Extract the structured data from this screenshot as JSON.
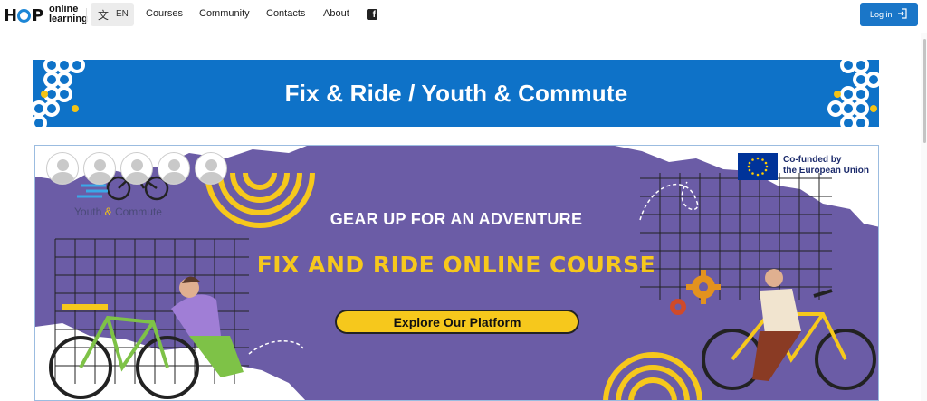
{
  "header": {
    "logo": {
      "brand": "HOP",
      "line1": "online",
      "line2": "learning"
    },
    "language": {
      "icon": "translate-icon",
      "label": "EN"
    },
    "nav": [
      {
        "label": "Courses"
      },
      {
        "label": "Community"
      },
      {
        "label": "Contacts"
      },
      {
        "label": "About"
      }
    ],
    "social_icon": "facebook-icon",
    "login": {
      "label": "Log in",
      "icon": "login-arrow-icon"
    }
  },
  "banner": {
    "title": "Fix & Ride / Youth & Commute"
  },
  "hero": {
    "project_label_a": "Youth ",
    "project_label_amp": "&",
    "project_label_b": " Commute",
    "eu_line1": "Co-funded by",
    "eu_line2": "the European Union",
    "tagline": "GEAR UP FOR AN ADVENTURE",
    "course_title": "FIX AND RIDE ONLINE COURSE",
    "cta_label": "Explore Our Platform"
  },
  "colors": {
    "header_accent": "#1a76c8",
    "banner_blue": "#0e72c8",
    "hero_purple": "#6b5ca6",
    "hero_yellow": "#f6c81c"
  }
}
